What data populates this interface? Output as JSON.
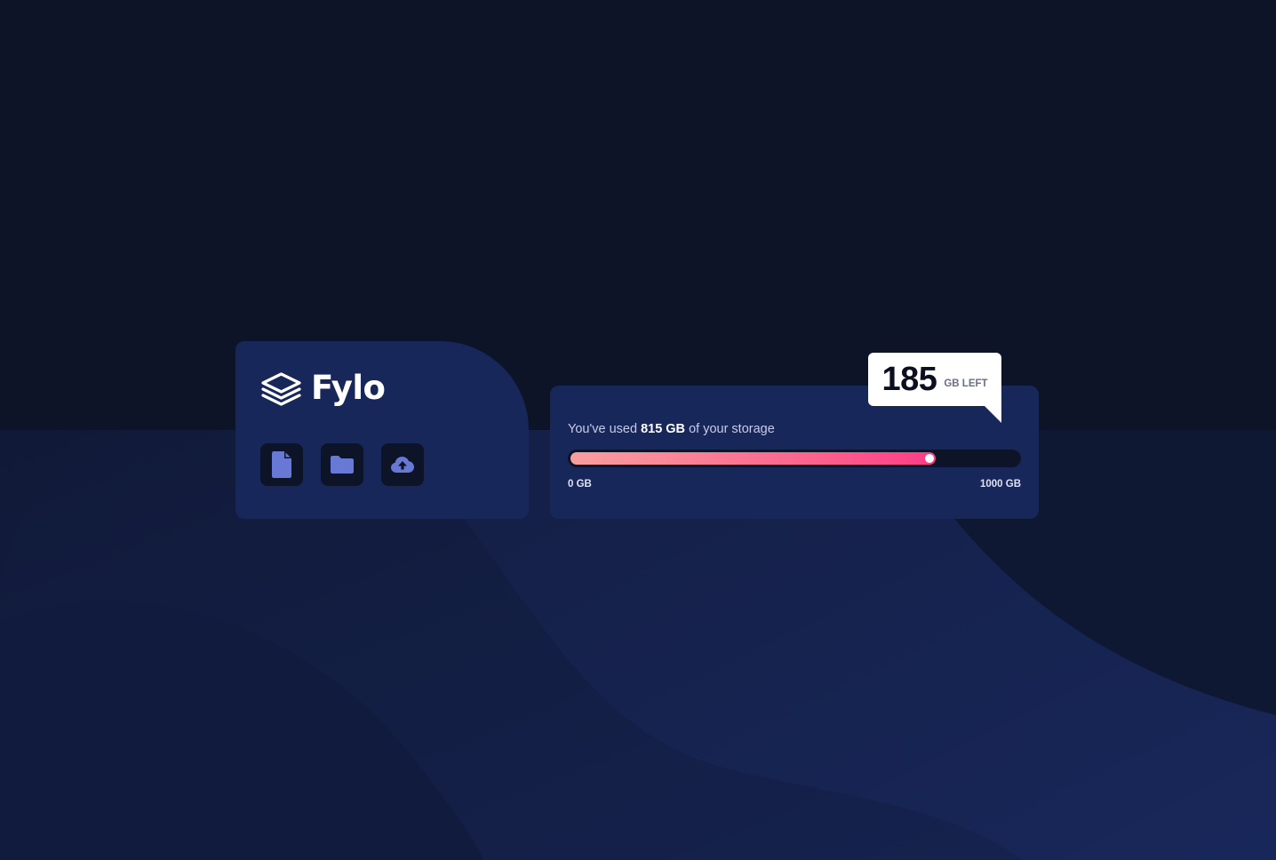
{
  "brand": {
    "name": "Fylo"
  },
  "actions": [
    {
      "icon": "document-icon"
    },
    {
      "icon": "folder-icon"
    },
    {
      "icon": "cloud-upload-icon"
    }
  ],
  "usage": {
    "prefix": "You've used ",
    "used": "815 GB",
    "suffix": " of your storage",
    "used_gb": 815,
    "total_gb": 1000,
    "min_label": "0 GB",
    "max_label": "1000 GB"
  },
  "remaining": {
    "value": "185",
    "label": "GB LEFT"
  },
  "colors": {
    "background": "#0d1428",
    "card": "#18275a",
    "icon": "#6778d5",
    "gradient_start": "#f99f9f",
    "gradient_end": "#fc3c87"
  }
}
